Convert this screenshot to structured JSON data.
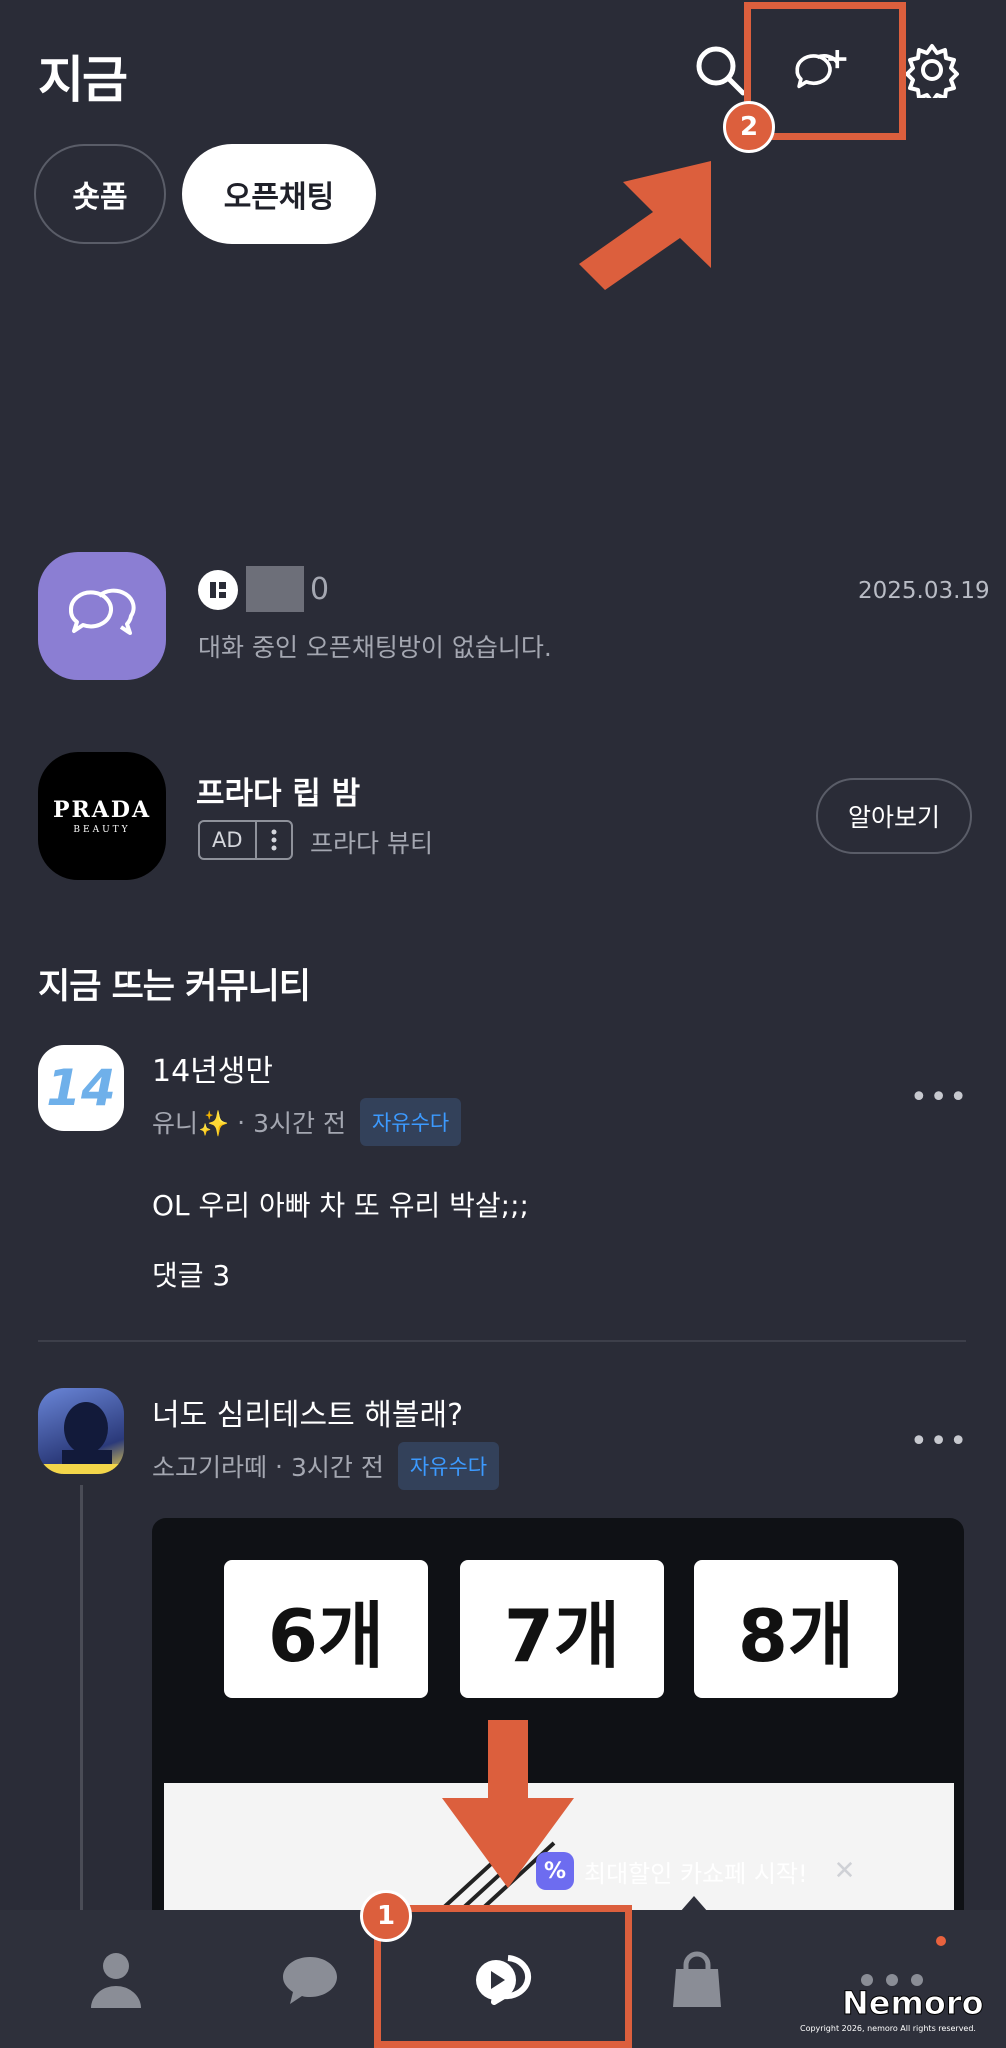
{
  "header": {
    "title": "지금"
  },
  "tabs": [
    {
      "label": "숏폼"
    },
    {
      "label": "오픈채팅"
    }
  ],
  "open_chat": {
    "count": "0",
    "date": "2025.03.19",
    "message": "대화 중인 오픈채팅방이 없습니다."
  },
  "ad": {
    "title": "프라다 립 밤",
    "badge": "AD",
    "brand": "프라다 뷰티",
    "button": "알아보기",
    "logo_text": "PRADA",
    "logo_sub": "BEAUTY"
  },
  "section_title": "지금 뜨는 커뮤니티",
  "posts": [
    {
      "title": "14년생만",
      "author": "유니✨",
      "time": "3시간 전",
      "tag": "자유수다",
      "body": "OL 우리 아빠 차 또 유리 박살;;;",
      "comments": "댓글 3",
      "more": "•••",
      "avatar_text": "14"
    },
    {
      "title": "너도 심리테스트 해볼래?",
      "author": "소고기라떼",
      "time": "3시간 전",
      "tag": "자유수다",
      "more": "•••"
    }
  ],
  "quiz": {
    "options": [
      "6개",
      "7개",
      "8개"
    ]
  },
  "toast": {
    "icon": "%",
    "text": "최대할인 카쇼페 시작!",
    "close": "✕"
  },
  "annotations": {
    "step1": "1",
    "step2": "2",
    "color": "#dc5f3d"
  },
  "watermark": "Nemoro",
  "copyright": "Copyright 2026, nemoro All rights reserved."
}
